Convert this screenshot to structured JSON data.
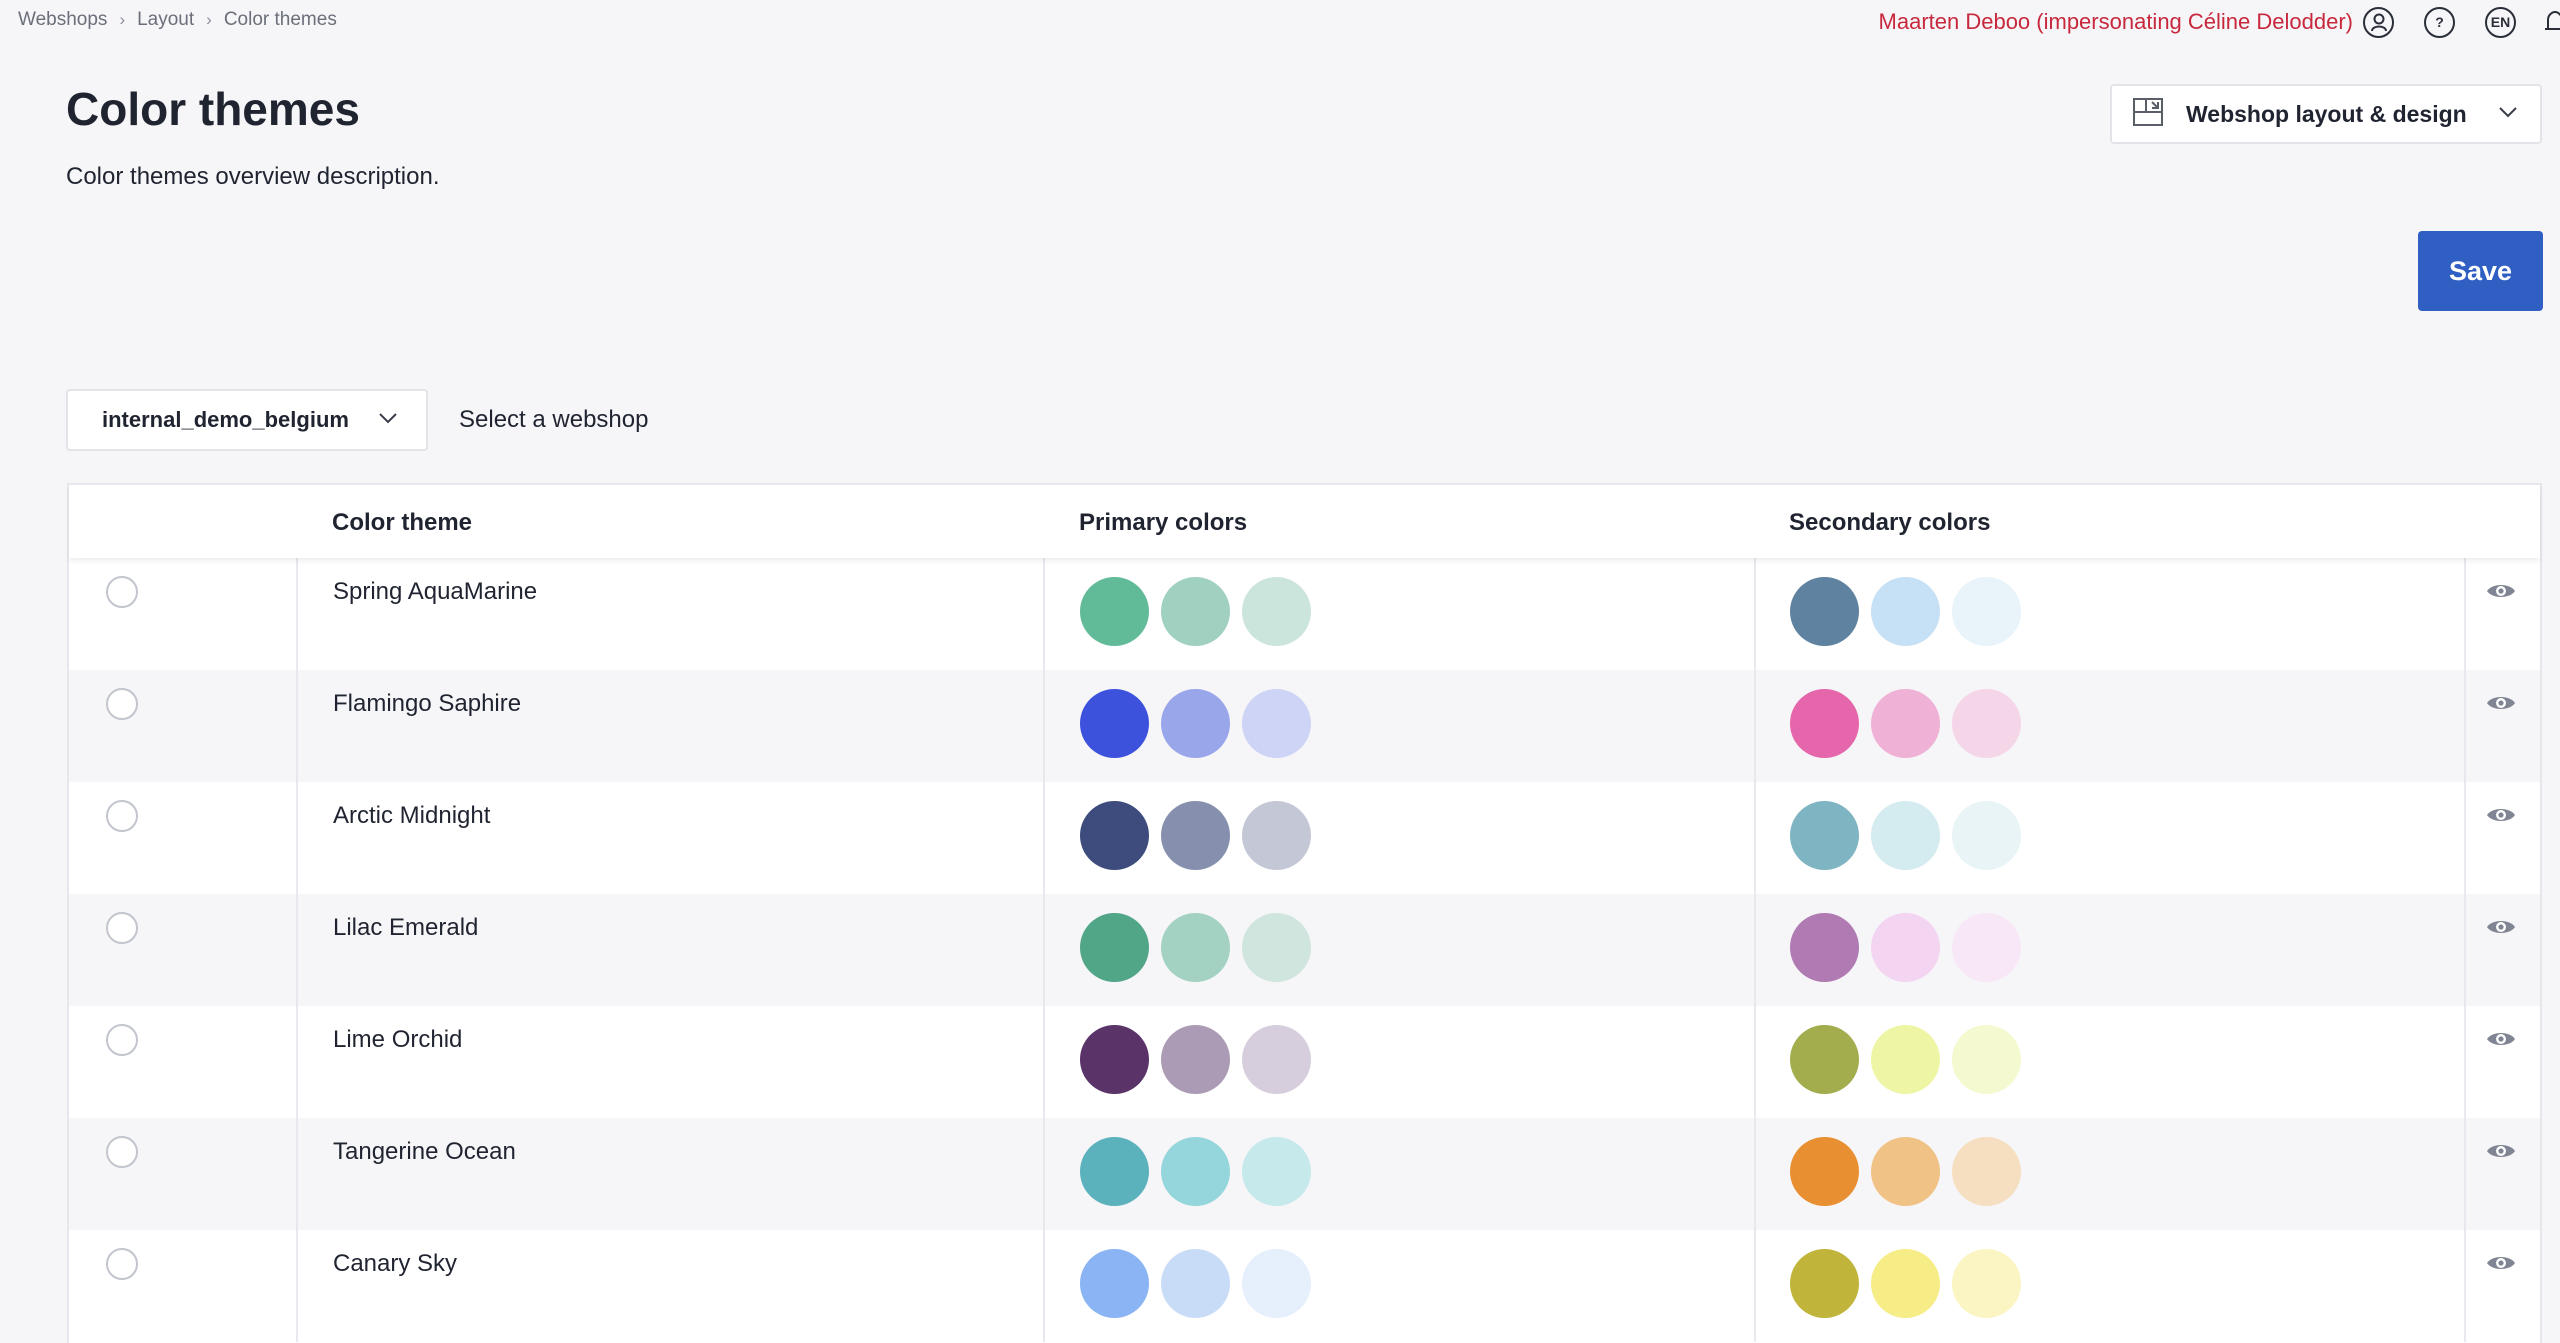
{
  "breadcrumb": {
    "items": [
      "Webshops",
      "Layout",
      "Color themes"
    ]
  },
  "topbar": {
    "user": "Maarten Deboo (impersonating Céline Delodder)",
    "help": "?",
    "lang": "EN"
  },
  "page": {
    "title": "Color themes",
    "description": "Color themes overview description."
  },
  "section_select": {
    "label": "Webshop layout & design"
  },
  "save": {
    "label": "Save"
  },
  "webshop_select": {
    "value": "internal_demo_belgium",
    "hint": "Select a webshop"
  },
  "table": {
    "headers": {
      "theme": "Color theme",
      "primary": "Primary colors",
      "secondary": "Secondary colors"
    },
    "rows": [
      {
        "name": "Spring AquaMarine",
        "primary": [
          "#62bb98",
          "#a0d1c0",
          "#cce5dc"
        ],
        "secondary": [
          "#5f82a0",
          "#c6e0f5",
          "#e8f3fa"
        ]
      },
      {
        "name": "Flamingo Saphire",
        "primary": [
          "#3c52dc",
          "#9aa6ea",
          "#ced4f5"
        ],
        "secondary": [
          "#e566ab",
          "#efb1d5",
          "#f5d6e8"
        ]
      },
      {
        "name": "Arctic Midnight",
        "primary": [
          "#3d4c7c",
          "#8690ae",
          "#c4c7d6"
        ],
        "secondary": [
          "#7fb5c2",
          "#d4ebef",
          "#e8f4f6"
        ]
      },
      {
        "name": "Lilac Emerald",
        "primary": [
          "#52a688",
          "#a3d1c2",
          "#cfe5de"
        ],
        "secondary": [
          "#b07ab3",
          "#f3d4f1",
          "#f8e8f7"
        ]
      },
      {
        "name": "Lime Orchid",
        "primary": [
          "#5a3468",
          "#ac9bb5",
          "#d6cedc"
        ],
        "secondary": [
          "#a3ad4e",
          "#eef5a5",
          "#f4f9d0"
        ]
      },
      {
        "name": "Tangerine Ocean",
        "primary": [
          "#5cb2bc",
          "#94d6db",
          "#c6e9eb"
        ],
        "secondary": [
          "#e88f32",
          "#f0c285",
          "#f5dfc0"
        ]
      },
      {
        "name": "Canary Sky",
        "primary": [
          "#8ab4f4",
          "#c9dcf7",
          "#e6effc"
        ],
        "secondary": [
          "#c0b43a",
          "#f6ed86",
          "#faf5c2"
        ]
      }
    ]
  }
}
